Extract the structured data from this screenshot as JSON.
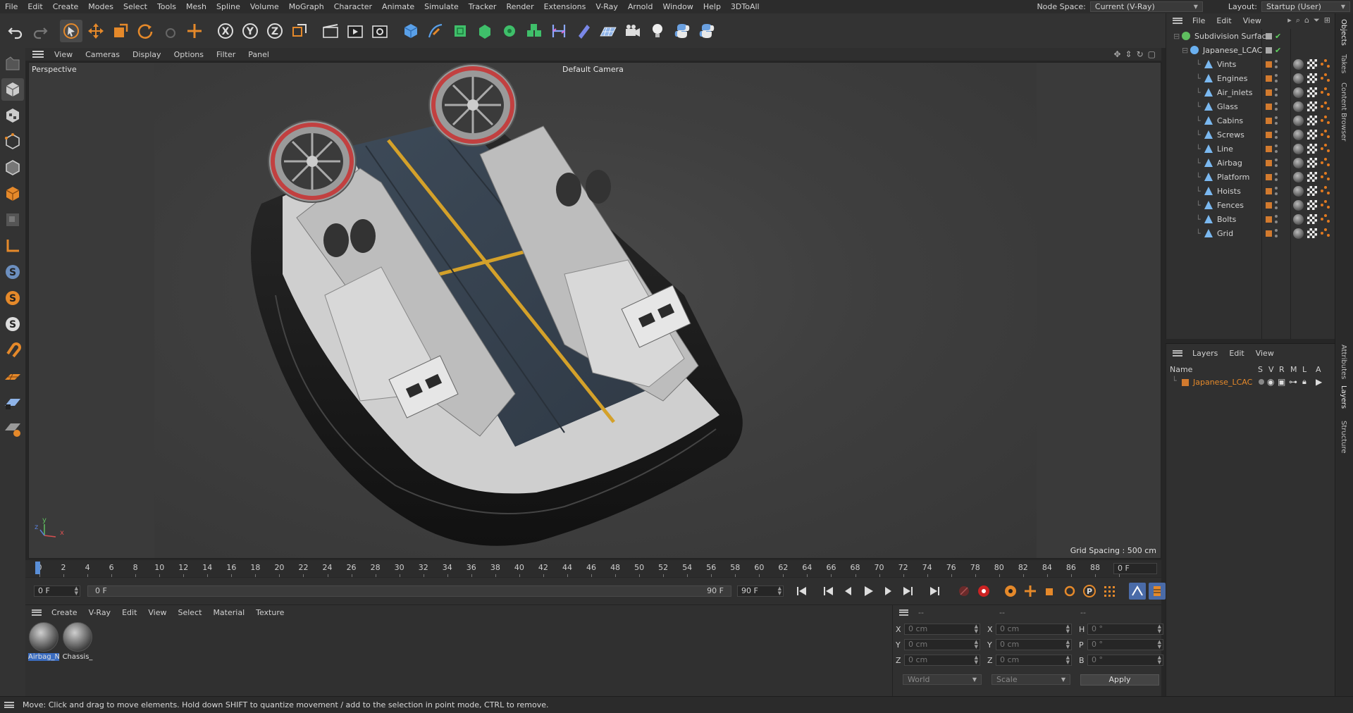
{
  "menubar": {
    "items": [
      "File",
      "Edit",
      "Create",
      "Modes",
      "Select",
      "Tools",
      "Mesh",
      "Spline",
      "Volume",
      "MoGraph",
      "Character",
      "Animate",
      "Simulate",
      "Tracker",
      "Render",
      "Extensions",
      "V-Ray",
      "Arnold",
      "Window",
      "Help",
      "3DToAll"
    ],
    "node_space_label": "Node Space:",
    "node_space_value": "Current (V-Ray)",
    "layout_label": "Layout:",
    "layout_value": "Startup (User)"
  },
  "viewport_menu": {
    "items": [
      "View",
      "Cameras",
      "Display",
      "Options",
      "Filter",
      "Panel"
    ]
  },
  "viewport": {
    "view_name": "Perspective",
    "camera_name": "Default Camera",
    "grid_spacing": "Grid Spacing : 500 cm",
    "axis_x": "x",
    "axis_y": "y",
    "axis_z": "z"
  },
  "timeline": {
    "ticks": [
      "0",
      "2",
      "4",
      "6",
      "8",
      "10",
      "12",
      "14",
      "16",
      "18",
      "20",
      "22",
      "24",
      "26",
      "28",
      "30",
      "32",
      "34",
      "36",
      "38",
      "40",
      "42",
      "44",
      "46",
      "48",
      "50",
      "52",
      "54",
      "56",
      "58",
      "60",
      "62",
      "64",
      "66",
      "68",
      "70",
      "72",
      "74",
      "76",
      "78",
      "80",
      "82",
      "84",
      "86",
      "88",
      "90"
    ],
    "current_frame": "0 F"
  },
  "transport": {
    "start_frame": "0 F",
    "range_start": "0 F",
    "range_end": "90 F",
    "end_frame": "90 F"
  },
  "material_manager": {
    "menu": [
      "Create",
      "V-Ray",
      "Edit",
      "View",
      "Select",
      "Material",
      "Texture"
    ],
    "materials": [
      {
        "name": "Airbag_N",
        "selected": true
      },
      {
        "name": "Chassis_",
        "selected": false
      }
    ]
  },
  "coordinates": {
    "headers": [
      "--",
      "--",
      "--"
    ],
    "rows": [
      {
        "l1": "X",
        "v1": "0 cm",
        "l2": "X",
        "v2": "0 cm",
        "l3": "H",
        "v3": "0 °"
      },
      {
        "l1": "Y",
        "v1": "0 cm",
        "l2": "Y",
        "v2": "0 cm",
        "l3": "P",
        "v3": "0 °"
      },
      {
        "l1": "Z",
        "v1": "0 cm",
        "l2": "Z",
        "v2": "0 cm",
        "l3": "B",
        "v3": "0 °"
      }
    ],
    "mode": "World",
    "size_mode": "Scale",
    "apply_label": "Apply"
  },
  "object_manager": {
    "menu": [
      "File",
      "Edit",
      "View"
    ],
    "root": "Subdivision Surface",
    "group": "Japanese_LCAC",
    "children": [
      "Vints",
      "Engines",
      "Air_inlets",
      "Glass",
      "Cabins",
      "Screws",
      "Line",
      "Airbag",
      "Platform",
      "Hoists",
      "Fences",
      "Bolts",
      "Grid"
    ]
  },
  "layer_manager": {
    "menu": [
      "Layers",
      "Edit",
      "View"
    ],
    "col_name": "Name",
    "cols": [
      "S",
      "V",
      "R",
      "M",
      "L",
      "A"
    ],
    "layer_name": "Japanese_LCAC",
    "layer_color": "#d27a2e"
  },
  "right_tabs": [
    "Objects",
    "Takes",
    "Content Browser",
    "Attributes",
    "Layers",
    "Structure"
  ],
  "status": {
    "text": "Move: Click and drag to move elements. Hold down SHIFT to quantize movement / add to the selection in point mode, CTRL to remove."
  },
  "colors": {
    "accent_blue": "#3a6cc0",
    "orange": "#e5892a",
    "layer_orange": "#d27a2e"
  }
}
